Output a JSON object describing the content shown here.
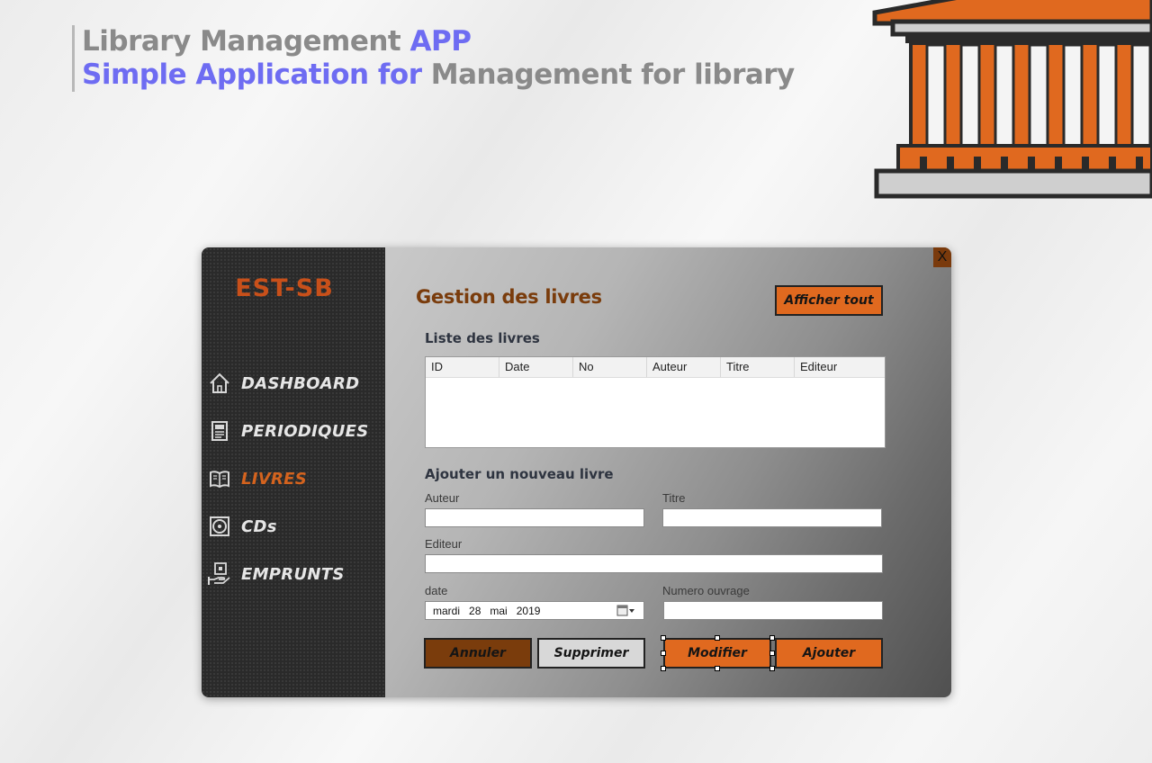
{
  "promo": {
    "line1_text": "Library Management ",
    "line1_highlight": "APP",
    "line2_highlight": "Simple Application for",
    "line2_text": " Management for library"
  },
  "app": {
    "logo": "EST-SB",
    "close_label": "X",
    "nav": [
      {
        "label": "DASHBOARD",
        "icon": "home-icon",
        "active": false
      },
      {
        "label": "PERIODIQUES",
        "icon": "newspaper-icon",
        "active": false
      },
      {
        "label": "LIVRES",
        "icon": "book-icon",
        "active": true
      },
      {
        "label": "CDs",
        "icon": "cd-icon",
        "active": false
      },
      {
        "label": "EMPRUNTS",
        "icon": "hand-borrow-icon",
        "active": false
      }
    ],
    "page_title": "Gestion des livres",
    "show_all_button": "Afficher tout",
    "list_title": "Liste des livres",
    "table_columns": [
      "ID",
      "Date",
      "No",
      "Auteur",
      "Titre",
      "Editeur"
    ],
    "form_title": "Ajouter un nouveau livre",
    "fields": {
      "auteur": {
        "label": "Auteur",
        "value": ""
      },
      "titre": {
        "label": "Titre",
        "value": ""
      },
      "editeur": {
        "label": "Editeur",
        "value": ""
      },
      "date": {
        "label": "date",
        "day_name": "mardi",
        "day": "28",
        "month": "mai",
        "year": "2019"
      },
      "numero": {
        "label": "Numero ouvrage",
        "value": ""
      }
    },
    "buttons": {
      "cancel": "Annuler",
      "delete": "Supprimer",
      "modify": "Modifier",
      "add": "Ajouter"
    },
    "colors": {
      "accent_orange": "#e0691f",
      "accent_dark": "#7a3c0c",
      "highlight_blue": "#6e6cf2",
      "sidebar_bg": "#2a2a2a"
    }
  }
}
